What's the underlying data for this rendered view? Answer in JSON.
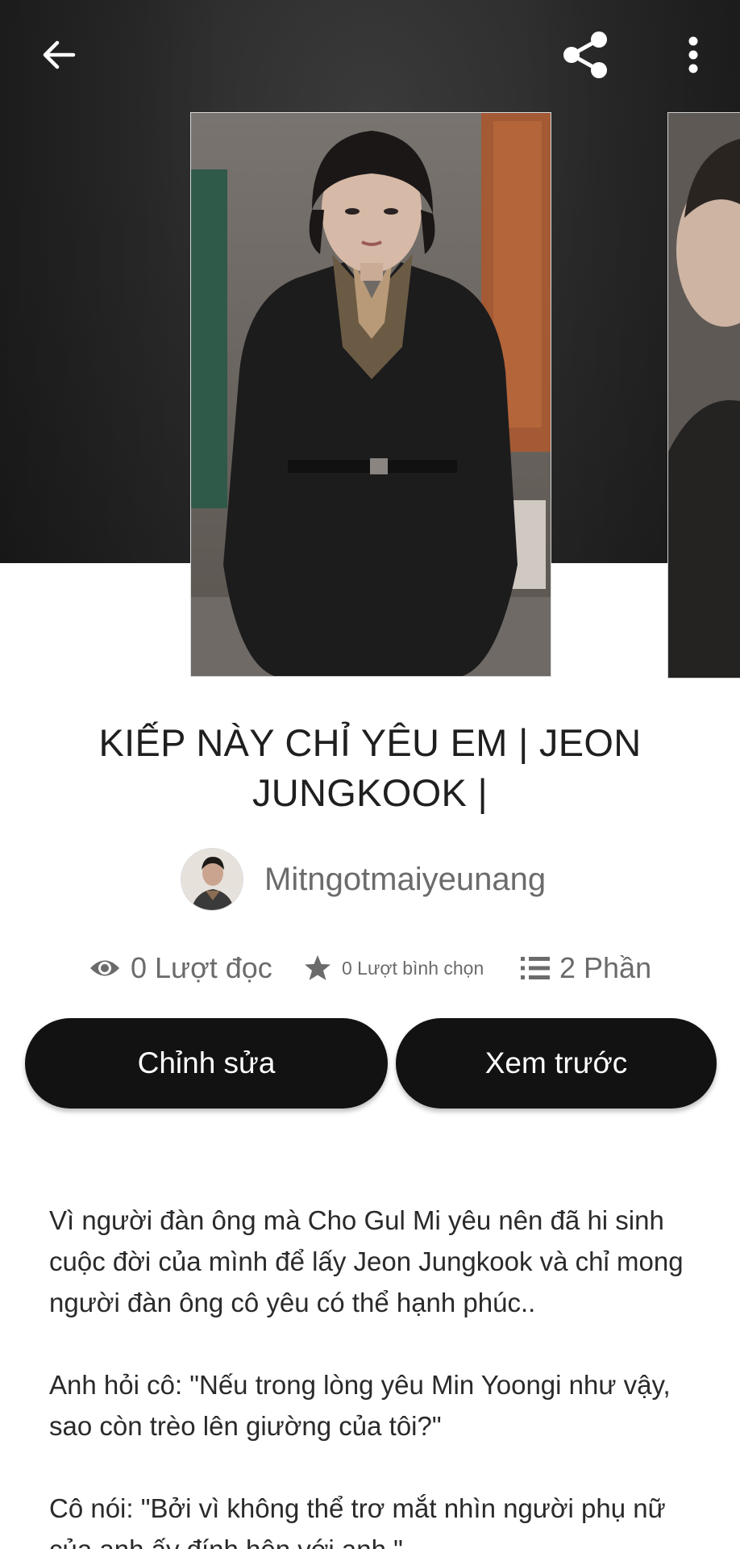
{
  "top_bar": {
    "back_icon": "arrow-left-icon",
    "share_icon": "share-icon",
    "more_icon": "more-vertical-icon"
  },
  "cover": {
    "main_alt": "Ảnh bìa",
    "next_alt": "Ảnh bìa tiếp theo"
  },
  "story": {
    "title": "KIẾP NÀY CHỈ YÊU EM | JEON JUNGKOOK |",
    "author": "Mitngotmaiyeunang"
  },
  "stats": {
    "reads": "0 Lượt đọc",
    "reads_icon": "eye-icon",
    "votes": "0 Lượt bình chọn",
    "votes_icon": "star-icon",
    "parts": "2 Phần",
    "parts_icon": "list-icon"
  },
  "actions": {
    "edit_label": "Chỉnh sửa",
    "preview_label": "Xem trước"
  },
  "description": {
    "paragraphs": [
      "Vì người đàn ông mà Cho Gul Mi yêu nên đã hi sinh cuộc đời của mình để lấy Jeon Jungkook và chỉ mong người đàn ông cô yêu có thể hạnh phúc..",
      "Anh hỏi cô: \"Nếu trong lòng yêu Min Yoongi như vậy, sao còn trèo lên giường của tôi?\"",
      "Cô nói: \"Bởi vì không thể trơ mắt nhìn người phụ nữ của anh ấy đính hôn với anh.\""
    ]
  },
  "colors": {
    "button_bg": "#121212",
    "button_text": "#ffffff",
    "muted_text": "#6b6b6b",
    "hero_bg": "#2b2b2b"
  }
}
